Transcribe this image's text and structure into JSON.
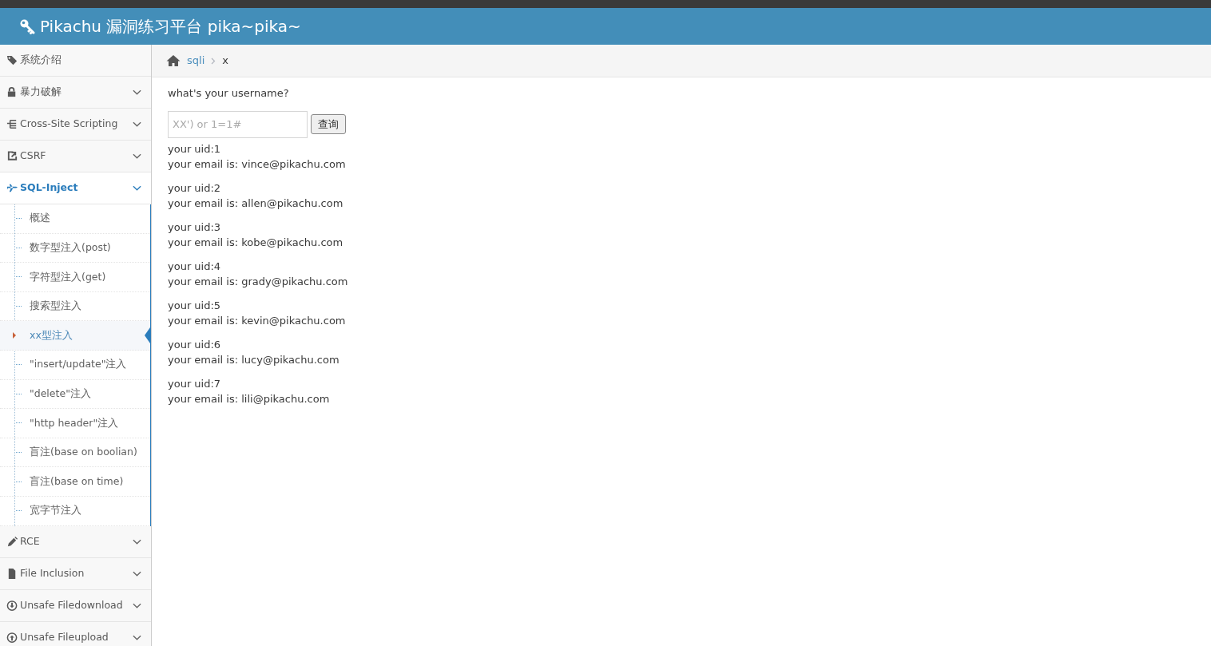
{
  "header": {
    "title": "Pikachu 漏洞练习平台 pika~pika~"
  },
  "sidebar": {
    "items": [
      {
        "label": "系统介绍",
        "kind": "link",
        "selected": false
      },
      {
        "label": "暴力破解",
        "kind": "menu",
        "selected": false
      },
      {
        "label": "Cross-Site Scripting",
        "kind": "menu",
        "selected": false
      },
      {
        "label": "CSRF",
        "kind": "menu",
        "selected": false
      },
      {
        "label": "SQL-Inject",
        "kind": "menu",
        "selected": true,
        "children": [
          {
            "label": "概述",
            "selected": false
          },
          {
            "label": "数字型注入(post)",
            "selected": false
          },
          {
            "label": "字符型注入(get)",
            "selected": false
          },
          {
            "label": "搜索型注入",
            "selected": false
          },
          {
            "label": "xx型注入",
            "selected": true
          },
          {
            "label": "\"insert/update\"注入",
            "selected": false
          },
          {
            "label": "\"delete\"注入",
            "selected": false
          },
          {
            "label": "\"http header\"注入",
            "selected": false
          },
          {
            "label": "盲注(base on boolian)",
            "selected": false
          },
          {
            "label": "盲注(base on time)",
            "selected": false
          },
          {
            "label": "宽字节注入",
            "selected": false
          }
        ]
      },
      {
        "label": "RCE",
        "kind": "menu",
        "selected": false
      },
      {
        "label": "File Inclusion",
        "kind": "menu",
        "selected": false
      },
      {
        "label": "Unsafe Filedownload",
        "kind": "menu",
        "selected": false
      },
      {
        "label": "Unsafe Fileupload",
        "kind": "menu",
        "selected": false
      }
    ]
  },
  "breadcrumb": [
    "sqli",
    "x"
  ],
  "form": {
    "prompt": "what's your username?",
    "placeholder": "XX') or 1=1#",
    "button": "查询"
  },
  "results": [
    {
      "uid": "your uid:1",
      "email": "your email is: vince@pikachu.com"
    },
    {
      "uid": "your uid:2",
      "email": "your email is: allen@pikachu.com"
    },
    {
      "uid": "your uid:3",
      "email": "your email is: kobe@pikachu.com"
    },
    {
      "uid": "your uid:4",
      "email": "your email is: grady@pikachu.com"
    },
    {
      "uid": "your uid:5",
      "email": "your email is: kevin@pikachu.com"
    },
    {
      "uid": "your uid:6",
      "email": "your email is: lucy@pikachu.com"
    },
    {
      "uid": "your uid:7",
      "email": "your email is: lili@pikachu.com"
    }
  ]
}
